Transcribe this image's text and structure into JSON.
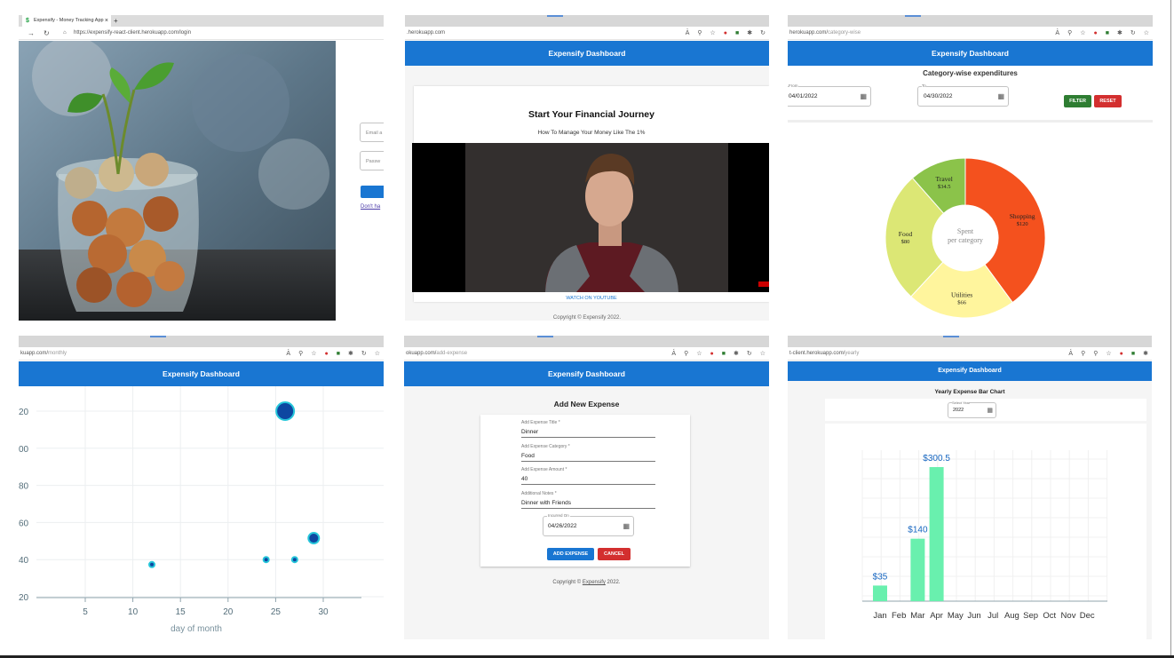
{
  "login": {
    "tab_title": "Expensify - Money Tracking App",
    "tab_close": "×",
    "new_tab": "+",
    "url": "https://expensify-react-client.herokuapp.com/login",
    "email_placeholder": "Email a",
    "password_placeholder": "Passw",
    "signup_link": "Don't ha"
  },
  "home": {
    "url": ".herokuapp.com",
    "appbar_title": "Expensify Dashboard",
    "heading": "Start Your Financial Journey",
    "subheading": "How To Manage Your Money Like The 1%",
    "watch_link": "WATCH ON YOUTUBE",
    "footer": "Copyright © Expensify 2022."
  },
  "category": {
    "url_host": "herokuapp.com/",
    "url_path": "category-wise",
    "appbar_title": "Expensify Dashboard",
    "title": "Category-wise expenditures",
    "from_label": "From",
    "from_value": "04/01/2022",
    "to_label": "To",
    "to_value": "04/30/2022",
    "filter_label": "FILTER",
    "reset_label": "RESET",
    "center_line1": "Spent",
    "center_line2": "per category"
  },
  "monthly": {
    "url_host": "kuapp.com/",
    "url_path": "monthly",
    "appbar_title": "Expensify Dashboard"
  },
  "add_expense": {
    "url_host": "okuapp.com/",
    "url_path": "add-expense",
    "appbar_title": "Expensify Dashboard",
    "title": "Add New Expense",
    "fields": [
      {
        "label": "Add Expense Title *",
        "value": "Dinner"
      },
      {
        "label": "Add Expense Category *",
        "value": "Food"
      },
      {
        "label": "Add Expense Amount *",
        "value": "40"
      },
      {
        "label": "Additional Notes *",
        "value": "Dinner with Friends"
      }
    ],
    "date_label": "Incurred On",
    "date_value": "04/26/2022",
    "add_label": "ADD EXPENSE",
    "cancel_label": "CANCEL",
    "footer_prefix": "Copyright © ",
    "footer_link": "Expensify",
    "footer_suffix": " 2022."
  },
  "yearly": {
    "url_host": "t-client.herokuapp.com/",
    "url_path": "yearly",
    "appbar_title": "Expensify Dashboard",
    "title": "Yearly Expense Bar Chart",
    "year_label": "Select Year",
    "year_value": "2022"
  },
  "colors": {
    "primary": "#1976d2",
    "filter_green": "#2e7d32",
    "reset_red": "#d32f2f",
    "bar_green": "#69f0ae",
    "bar_label": "#1565c0"
  },
  "chart_data": [
    {
      "type": "pie",
      "variant": "donut",
      "categories": [
        "Shopping",
        "Utilities",
        "Food",
        "Travel"
      ],
      "values": [
        120,
        66,
        80,
        34.5
      ],
      "value_labels": [
        "$120",
        "$66",
        "$80",
        "$34.5"
      ],
      "colors": [
        "#f4511e",
        "#fff59d",
        "#dce775",
        "#8bc34a"
      ]
    },
    {
      "type": "scatter",
      "xlabel": "day of month",
      "xticks": [
        5,
        10,
        15,
        20,
        25,
        30
      ],
      "yticks": [
        "20",
        "00",
        "80",
        "60",
        "40",
        "20"
      ],
      "points": [
        {
          "x": 12,
          "y": 34,
          "r": 3
        },
        {
          "x": 24,
          "y": 40,
          "r": 3
        },
        {
          "x": 26,
          "y": 220,
          "r": 10
        },
        {
          "x": 27,
          "y": 40,
          "r": 3
        },
        {
          "x": 29,
          "y": 66,
          "r": 6
        }
      ]
    },
    {
      "type": "bar",
      "categories": [
        "Jan",
        "Feb",
        "Mar",
        "Apr",
        "May",
        "Jun",
        "Jul",
        "Aug",
        "Sep",
        "Oct",
        "Nov",
        "Dec"
      ],
      "values": [
        35,
        0,
        140,
        300.5,
        0,
        0,
        0,
        0,
        0,
        0,
        0,
        0
      ],
      "value_labels": [
        "$35",
        "",
        "$140",
        "$300.5",
        "",
        "",
        "",
        "",
        "",
        "",
        "",
        ""
      ]
    }
  ]
}
